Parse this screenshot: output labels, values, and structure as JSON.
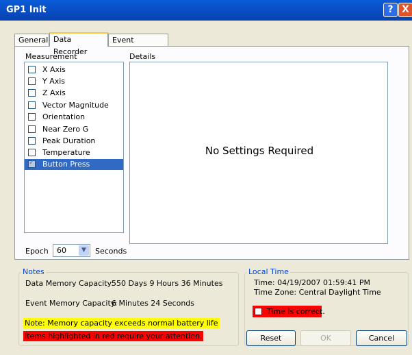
{
  "window": {
    "title": "GP1 Init",
    "help": "?",
    "close": "X"
  },
  "tabs": [
    "General",
    "Data Recorder",
    "Event Recorder"
  ],
  "measurement": {
    "header": "Measurement",
    "items": [
      {
        "label": "X Axis",
        "checked": false
      },
      {
        "label": "Y Axis",
        "checked": false
      },
      {
        "label": "Z Axis",
        "checked": false
      },
      {
        "label": "Vector Magnitude",
        "checked": false
      },
      {
        "label": "Orientation",
        "checked": false
      },
      {
        "label": "Near Zero G",
        "checked": false
      },
      {
        "label": "Peak Duration",
        "checked": false
      },
      {
        "label": "Temperature",
        "checked": false
      },
      {
        "label": "Button Press",
        "checked": true
      }
    ]
  },
  "details": {
    "header": "Details",
    "message": "No Settings Required"
  },
  "epoch": {
    "label": "Epoch",
    "value": "60",
    "unit": "Seconds"
  },
  "notes": {
    "legend": "Notes",
    "data_memory_label": "Data Memory Capacity:",
    "data_memory_value": "550 Days 9 Hours 36 Minutes",
    "event_memory_label": "Event Memory Capacity:",
    "event_memory_value": "6 Minutes 24 Seconds",
    "warning_yellow": "Note: Memory capacity exceeds normal battery life",
    "warning_red": "Items highlighted in red require your attention."
  },
  "local_time": {
    "legend": "Local Time",
    "time": "Time: 04/19/2007 01:59:41 PM",
    "zone": "Time Zone: Central Daylight Time",
    "confirm": "Time is correct."
  },
  "buttons": {
    "reset": "Reset",
    "ok": "OK",
    "cancel": "Cancel"
  },
  "colors": {
    "title_bar": "#0a5bd8",
    "selection": "#316ac5",
    "warning_yellow": "#ffff00",
    "warning_red": "#ff0000"
  }
}
